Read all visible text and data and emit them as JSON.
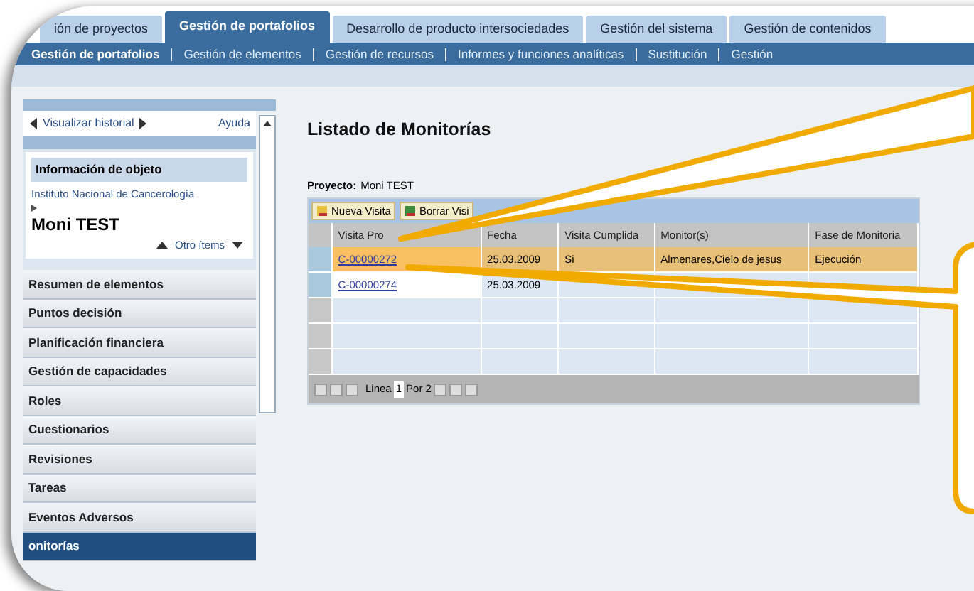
{
  "top_tabs": [
    {
      "label": "ión de proyectos",
      "selected": false
    },
    {
      "label": "Gestión de portafolios",
      "selected": true
    },
    {
      "label": "Desarrollo de producto intersociedades",
      "selected": false
    },
    {
      "label": "Gestión del sistema",
      "selected": false
    },
    {
      "label": "Gestión de contenidos",
      "selected": false
    }
  ],
  "sub_nav": [
    {
      "label": "Gestión de portafolios",
      "selected": true
    },
    {
      "label": "Gestión de elementos",
      "selected": false
    },
    {
      "label": "Gestión de recursos",
      "selected": false
    },
    {
      "label": "Informes y funciones analíticas",
      "selected": false
    },
    {
      "label": "Sustitución",
      "selected": false
    },
    {
      "label": "Gestión",
      "selected": false
    }
  ],
  "sidebar": {
    "history_link": "Visualizar historial",
    "help_link": "Ayuda",
    "object_info": {
      "title": "Información de objeto",
      "organization": "Instituto Nacional de Cancerología",
      "object_name": "Moni TEST",
      "other_items": "Otro ítems"
    },
    "items": [
      {
        "label": "Resumen de elementos",
        "selected": false
      },
      {
        "label": "Puntos decisión",
        "selected": false
      },
      {
        "label": "Planificación financiera",
        "selected": false
      },
      {
        "label": "Gestión de capacidades",
        "selected": false
      },
      {
        "label": "Roles",
        "selected": false
      },
      {
        "label": "Cuestionarios",
        "selected": false
      },
      {
        "label": "Revisiones",
        "selected": false
      },
      {
        "label": "Tareas",
        "selected": false
      },
      {
        "label": "Eventos Adversos",
        "selected": false
      },
      {
        "label": "onitorías",
        "selected": true
      }
    ]
  },
  "main": {
    "title": "Listado de Monitorías",
    "project_label": "Proyecto:",
    "project_value": "Moni TEST",
    "toolbar": [
      "Nueva Visita",
      "Borrar Visi"
    ],
    "table": {
      "columns": [
        "Visita Pro",
        "Fecha",
        "Visita Cumplida",
        "Monitor(s)",
        "Fase de Monitoria"
      ],
      "rows": [
        {
          "selected": true,
          "cells": [
            "C-00000272",
            "25.03.2009",
            "Si",
            "Almenares,Cielo de jesus",
            "Ejecución"
          ]
        },
        {
          "selected": false,
          "cells": [
            "C-00000274",
            "25.03.2009",
            "",
            "",
            ""
          ]
        }
      ],
      "pager": {
        "label": "Linea",
        "page": "1",
        "of": "Por 2"
      }
    }
  }
}
